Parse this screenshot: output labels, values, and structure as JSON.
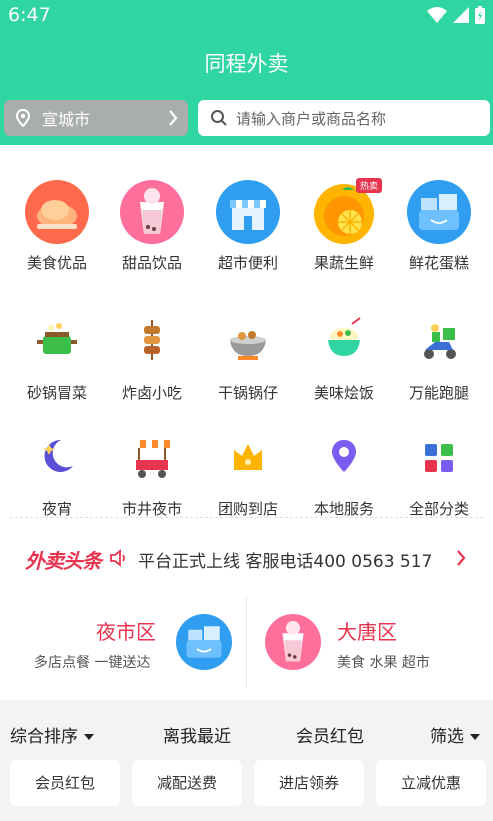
{
  "status_bar": {
    "time": "6:47"
  },
  "header": {
    "title": "同程外卖"
  },
  "location": {
    "city": "宣城市"
  },
  "search": {
    "placeholder": "请输入商户或商品名称"
  },
  "categories": [
    {
      "label": "美食优品",
      "icon": "roast-chicken-icon"
    },
    {
      "label": "甜品饮品",
      "icon": "bubble-tea-icon"
    },
    {
      "label": "超市便利",
      "icon": "store-icon"
    },
    {
      "label": "果蔬生鲜",
      "icon": "orange-icon",
      "badge": "热卖"
    },
    {
      "label": "鲜花蛋糕",
      "icon": "cake-box-icon"
    },
    {
      "label": "砂锅冒菜",
      "icon": "clay-pot-icon"
    },
    {
      "label": "炸卤小吃",
      "icon": "skewer-icon"
    },
    {
      "label": "干锅锅仔",
      "icon": "dry-pot-icon"
    },
    {
      "label": "美味烩饭",
      "icon": "rice-bowl-icon"
    },
    {
      "label": "万能跑腿",
      "icon": "delivery-scooter-icon"
    },
    {
      "label": "夜宵",
      "icon": "moon-icon"
    },
    {
      "label": "市井夜市",
      "icon": "food-stall-icon"
    },
    {
      "label": "团购到店",
      "icon": "crown-icon"
    },
    {
      "label": "本地服务",
      "icon": "location-pin-icon"
    },
    {
      "label": "全部分类",
      "icon": "grid-icon"
    }
  ],
  "news": {
    "brand": "外卖头条",
    "text": "平台正式上线 客服电话400 0563 517"
  },
  "promos": [
    {
      "title": "夜市区",
      "subtitle": "多店点餐 一键送达"
    },
    {
      "title": "大唐区",
      "subtitle": "美食 水果 超市"
    }
  ],
  "sort_bar": {
    "items": [
      "综合排序",
      "离我最近",
      "会员红包",
      "筛选"
    ]
  },
  "chips": [
    "会员红包",
    "减配送费",
    "进店领券",
    "立减优惠"
  ],
  "colors": {
    "brand": "#2fd6a2",
    "accent": "#e8344e"
  }
}
